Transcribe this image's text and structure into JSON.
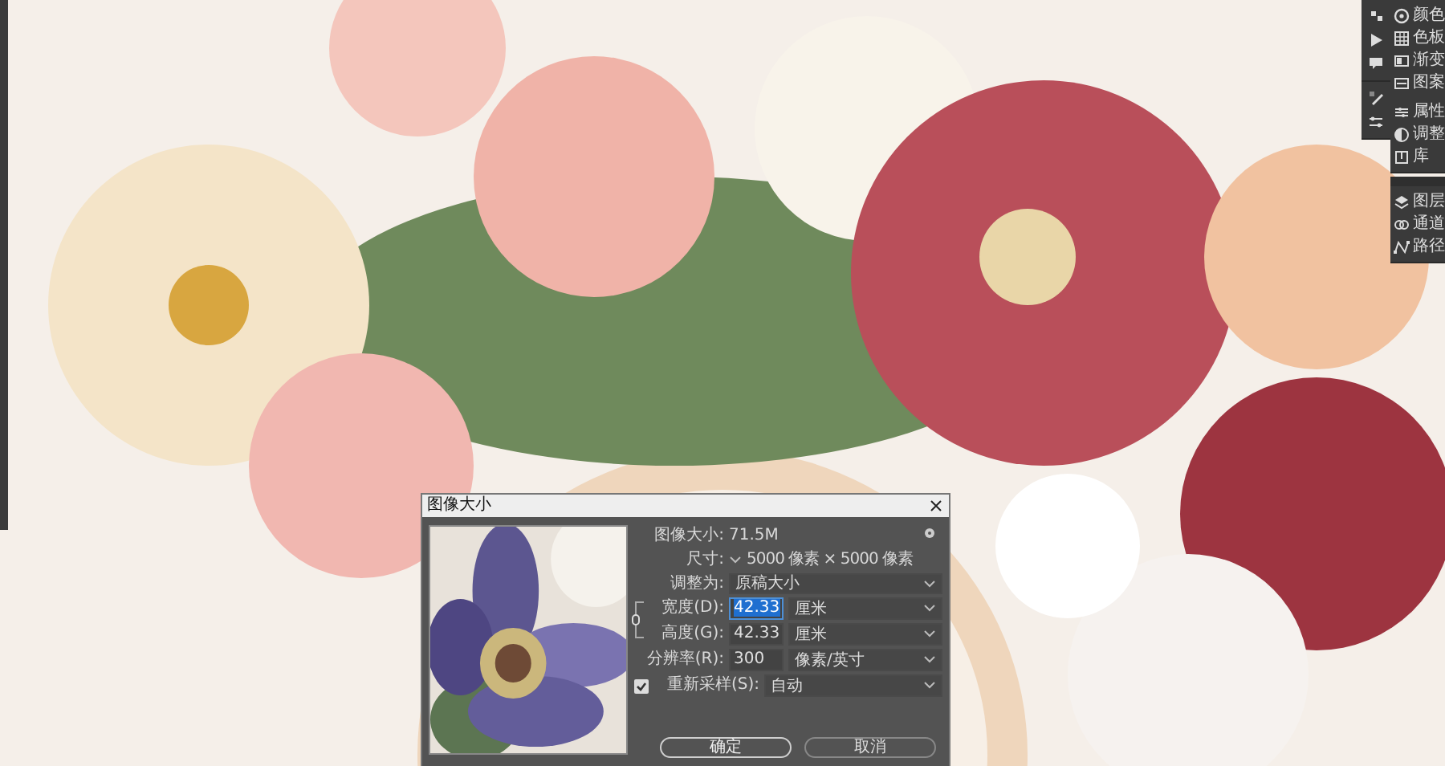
{
  "right_panel": {
    "groups": [
      {
        "items": [
          {
            "label": "颜色"
          },
          {
            "label": "色板"
          },
          {
            "label": "渐变"
          },
          {
            "label": "图案"
          }
        ]
      },
      {
        "items": [
          {
            "label": "属性"
          },
          {
            "label": "调整"
          },
          {
            "label": "库"
          }
        ]
      },
      {
        "items": [
          {
            "label": "图层"
          },
          {
            "label": "通道"
          },
          {
            "label": "路径"
          }
        ]
      }
    ]
  },
  "dialog": {
    "title": "图像大小",
    "image_size_label": "图像大小:",
    "image_size": "71.5M",
    "dimensions_label": "尺寸:",
    "dimensions": "5000 像素 × 5000 像素",
    "fit_label": "调整为:",
    "fit_value": "原稿大小",
    "fields": [
      {
        "label": "宽度(D):",
        "value": "42.33",
        "unit": "厘米",
        "selected": true
      },
      {
        "label": "高度(G):",
        "value": "42.33",
        "unit": "厘米",
        "selected": false
      },
      {
        "label": "分辨率(R):",
        "value": "300",
        "unit": "像素/英寸",
        "selected": false
      }
    ],
    "resample": {
      "label": "重新采样(S):",
      "checked": true,
      "value": "自动"
    },
    "buttons": [
      {
        "label": "确定",
        "kind": "primary"
      },
      {
        "label": "取消",
        "kind": "secondary"
      }
    ]
  }
}
